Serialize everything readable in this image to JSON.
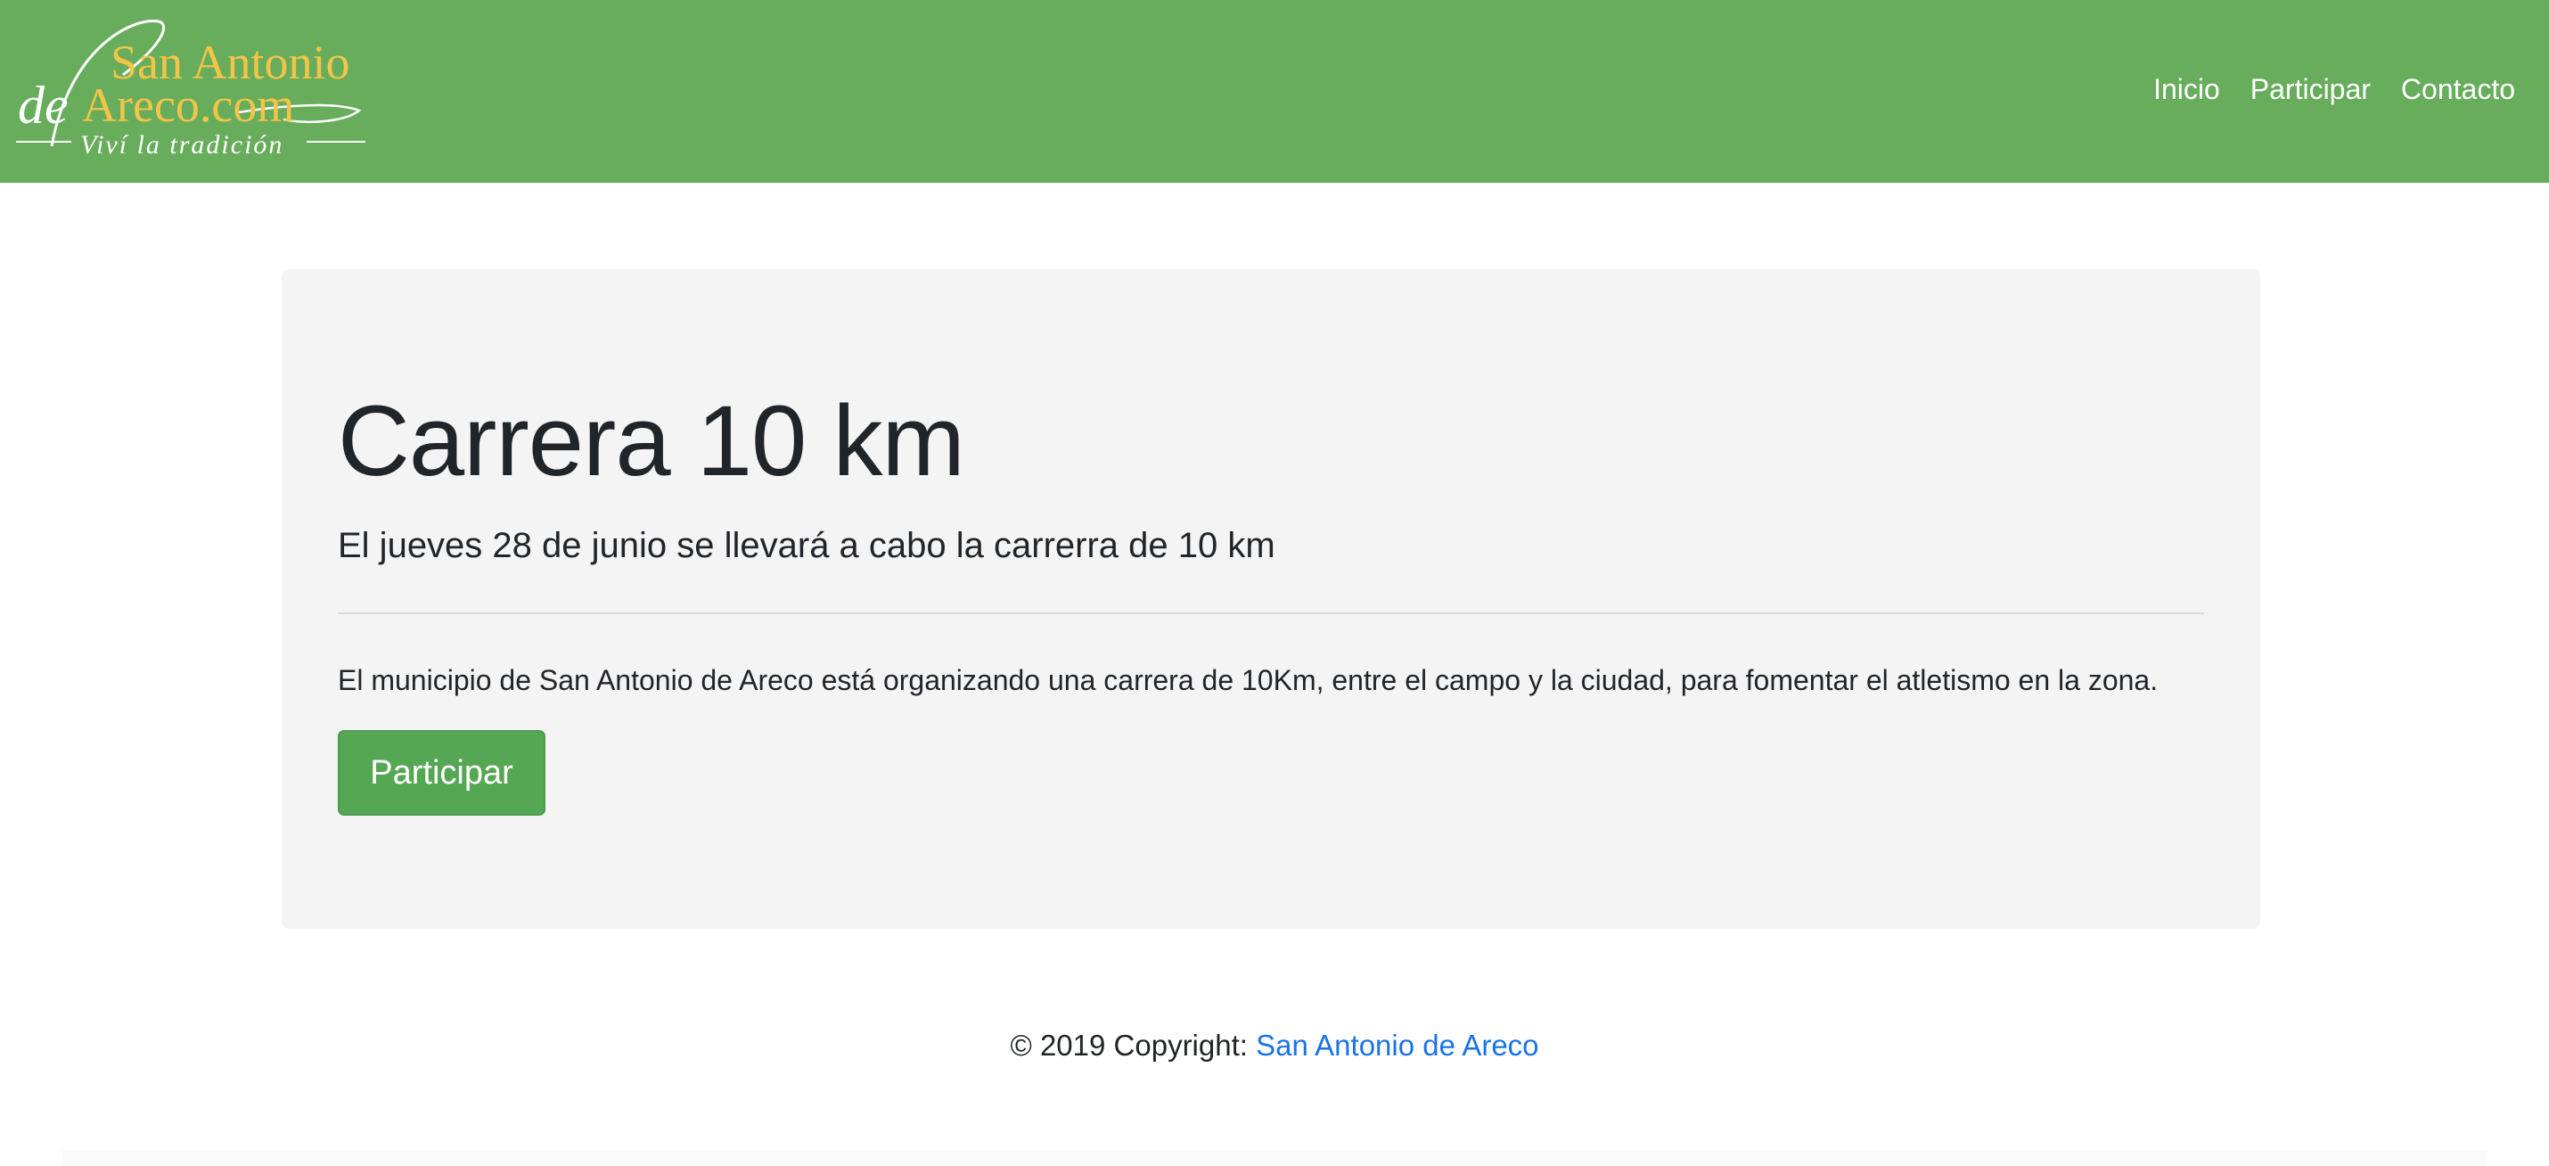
{
  "header": {
    "background_color": "#67ad5b",
    "logo": {
      "line1": "San Antonio",
      "line2_prefix": "de",
      "line2": "Areco.com",
      "tagline": "Viví la tradición",
      "accent_color": "#f3c448"
    },
    "nav": [
      {
        "label": "Inicio"
      },
      {
        "label": "Participar"
      },
      {
        "label": "Contacto"
      }
    ]
  },
  "jumbotron": {
    "title": "Carrera 10 km",
    "lead": "El jueves 28 de junio se llevará a cabo la carrerra de 10 km",
    "text": "El municipio de San Antonio de Areco está organizando una carrera de 10Km, entre el campo y la ciudad, para fomentar el atletismo en la zona.",
    "button_label": "Participar",
    "button_color": "#55a754"
  },
  "footer": {
    "copyright": "© 2019 Copyright: ",
    "link_label": "San Antonio de Areco",
    "link_color": "#1a73e8"
  }
}
